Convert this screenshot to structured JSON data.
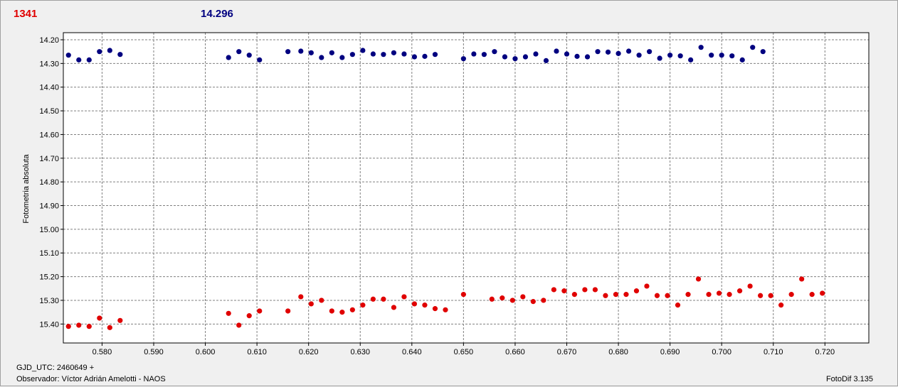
{
  "header": {
    "star_label": "1341",
    "comp_value": "14.296"
  },
  "colors": {
    "series_1": "#e00000",
    "series_2": "#000080",
    "grid": "#808080"
  },
  "footer": {
    "gjd": "GJD_UTC: 2460649 +",
    "observer": "Observador: Víctor Adrián Amelotti - NAOS",
    "version": "FotoDif 3.135"
  },
  "chart_data": {
    "type": "scatter",
    "ylabel": "Fotometria absoluta",
    "xlabel": "",
    "xlim": [
      0.5725,
      0.7285
    ],
    "ylim": [
      14.17,
      15.48
    ],
    "y_inverted": true,
    "grid": true,
    "xticks": [
      "0.580",
      "0.590",
      "0.600",
      "0.610",
      "0.620",
      "0.630",
      "0.640",
      "0.650",
      "0.660",
      "0.670",
      "0.680",
      "0.690",
      "0.700",
      "0.710",
      "0.720"
    ],
    "yticks": [
      "14.20",
      "14.30",
      "14.40",
      "14.50",
      "14.60",
      "14.70",
      "14.80",
      "14.90",
      "15.00",
      "15.10",
      "15.20",
      "15.30",
      "15.40"
    ],
    "series": [
      {
        "x": [
          0.5735,
          0.5755,
          0.5775,
          0.5795,
          0.5815,
          0.5835,
          0.6045,
          0.6065,
          0.6085,
          0.6105,
          0.616,
          0.6185,
          0.6205,
          0.6225,
          0.6245,
          0.6265,
          0.6285,
          0.6305,
          0.6325,
          0.6345,
          0.6365,
          0.6385,
          0.6405,
          0.6425,
          0.6445,
          0.6465,
          0.65,
          0.6555,
          0.6575,
          0.6595,
          0.6615,
          0.6635,
          0.6655,
          0.6675,
          0.6695,
          0.6715,
          0.6735,
          0.6755,
          0.6775,
          0.6795,
          0.6815,
          0.6835,
          0.6855,
          0.6875,
          0.6895,
          0.6915,
          0.6935,
          0.6955,
          0.6975,
          0.6995,
          0.7015,
          0.7035,
          0.7055,
          0.7075,
          0.7095,
          0.7115,
          0.7135,
          0.7155,
          0.7175,
          0.7195
        ],
        "values": [
          15.41,
          15.405,
          15.41,
          15.375,
          15.415,
          15.385,
          15.355,
          15.405,
          15.365,
          15.345,
          15.345,
          15.285,
          15.315,
          15.3,
          15.345,
          15.35,
          15.34,
          15.32,
          15.295,
          15.295,
          15.33,
          15.285,
          15.315,
          15.32,
          15.335,
          15.34,
          15.275,
          15.295,
          15.29,
          15.3,
          15.285,
          15.305,
          15.3,
          15.255,
          15.26,
          15.275,
          15.255,
          15.255,
          15.28,
          15.275,
          15.275,
          15.26,
          15.24,
          15.28,
          15.28,
          15.32,
          15.275,
          15.21,
          15.275,
          15.27,
          15.275,
          15.26,
          15.24,
          15.28,
          15.28,
          15.32,
          15.275,
          15.21,
          15.275,
          15.27
        ]
      },
      {
        "x": [
          0.5735,
          0.5755,
          0.5775,
          0.5795,
          0.5815,
          0.5835,
          0.6045,
          0.6065,
          0.6085,
          0.6105,
          0.616,
          0.6185,
          0.6205,
          0.6225,
          0.6245,
          0.6265,
          0.6285,
          0.6305,
          0.6325,
          0.6345,
          0.6365,
          0.6385,
          0.6405,
          0.6425,
          0.6445,
          0.65,
          0.652,
          0.654,
          0.656,
          0.658,
          0.66,
          0.662,
          0.664,
          0.666,
          0.668,
          0.67,
          0.672,
          0.674,
          0.676,
          0.678,
          0.68,
          0.682,
          0.684,
          0.686,
          0.688,
          0.69,
          0.692,
          0.694,
          0.696,
          0.698,
          0.7,
          0.702,
          0.704,
          0.706,
          0.708
        ],
        "values": [
          14.265,
          14.285,
          14.285,
          14.25,
          14.245,
          14.262,
          14.275,
          14.25,
          14.265,
          14.285,
          14.25,
          14.248,
          14.255,
          14.275,
          14.255,
          14.275,
          14.262,
          14.245,
          14.26,
          14.262,
          14.255,
          14.26,
          14.272,
          14.27,
          14.262,
          14.28,
          14.26,
          14.262,
          14.25,
          14.272,
          14.28,
          14.272,
          14.26,
          14.288,
          14.248,
          14.26,
          14.27,
          14.272,
          14.25,
          14.252,
          14.258,
          14.248,
          14.265,
          14.25,
          14.278,
          14.265,
          14.268,
          14.285,
          14.232,
          14.265,
          14.265,
          14.268,
          14.285,
          14.232,
          14.25
        ]
      }
    ]
  }
}
